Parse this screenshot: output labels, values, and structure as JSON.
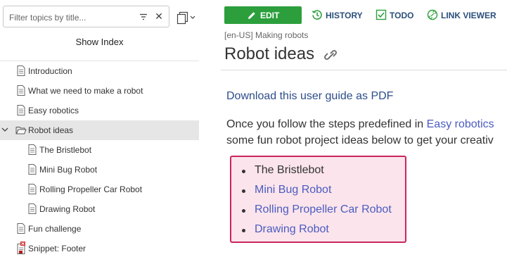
{
  "sidebar": {
    "filter": {
      "placeholder": "Filter topics by title...",
      "value": ""
    },
    "show_index_label": "Show Index",
    "items": [
      {
        "label": "Introduction",
        "icon": "page-icon"
      },
      {
        "label": "What we need to make a robot",
        "icon": "page-icon"
      },
      {
        "label": "Easy robotics",
        "icon": "page-icon"
      },
      {
        "label": "Robot ideas",
        "icon": "folder-open-icon",
        "expanded": true,
        "active": true
      },
      {
        "label": "The Bristlebot",
        "icon": "page-icon"
      },
      {
        "label": "Mini Bug Robot",
        "icon": "page-icon"
      },
      {
        "label": "Rolling Propeller Car Robot",
        "icon": "page-icon"
      },
      {
        "label": "Drawing Robot",
        "icon": "page-icon"
      },
      {
        "label": "Fun challenge",
        "icon": "page-icon"
      },
      {
        "label": "Snippet: Footer",
        "icon": "snippet-error-icon"
      }
    ]
  },
  "toolbar": {
    "edit_label": "EDIT",
    "history_label": "HISTORY",
    "todo_label": "TODO",
    "link_viewer_label": "LINK VIEWER"
  },
  "content": {
    "breadcrumb": "[en-US] Making robots",
    "title": "Robot ideas",
    "download_link": "Download this user guide as PDF",
    "para1_prefix": "Once you follow the steps predefined in ",
    "para1_link": "Easy robotics",
    "para2": "some fun robot project ideas below to get your creativ",
    "projects": [
      {
        "label": "The Bristlebot",
        "link": false
      },
      {
        "label": "Mini Bug Robot",
        "link": true
      },
      {
        "label": "Rolling Propeller Car Robot",
        "link": true
      },
      {
        "label": "Drawing Robot",
        "link": true
      }
    ]
  },
  "colors": {
    "edit_button": "#2c9f3c",
    "link": "#4a5cbf",
    "box_border": "#c8265f",
    "box_fill": "#fce4ec",
    "active_row": "#e6e6e6"
  }
}
